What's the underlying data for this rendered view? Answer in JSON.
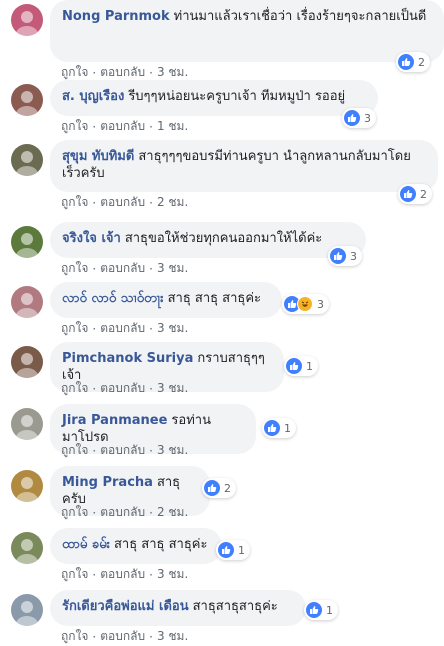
{
  "actions": {
    "like": "ถูกใจ",
    "reply": "ตอบกลับ",
    "dot": "·"
  },
  "comments": [
    {
      "name": "Nong Parnmok",
      "text": "ท่านมาแล้วเราเชื่อว่า เรื่องร้ายๆจะกลายเป็นดี",
      "time": "3 ชม.",
      "reactions": "2",
      "haha": false,
      "avatar_color": "#c45a7a"
    },
    {
      "name": "ส. บุญเรือง",
      "text": "รีบๆๆหน่อยนะครูบาเจ้า ทีมหมูป่า รออยู่",
      "time": "1 ชม.",
      "reactions": "3",
      "haha": false,
      "avatar_color": "#8b5a50"
    },
    {
      "name": "สุขุม ทับทิมดี",
      "text": "สาธุๆๆๆขอบรมีท่านครูบา นำลูกหลานกลับมาโดยเร็วครับ",
      "time": "2 ชม.",
      "reactions": "2",
      "haha": false,
      "avatar_color": "#6b6b52"
    },
    {
      "name": "จริงใจ เจ้า",
      "text": "สาธุขอให้ช่วยทุกคนออกมาให้ได้ค่ะ",
      "time": "3 ชม.",
      "reactions": "3",
      "haha": false,
      "avatar_color": "#5b7a3c"
    },
    {
      "name": "လာဝ် လာဝ် သၢဝ်တႃး",
      "text": "สาธุ สาธุ สาธุค่ะ",
      "time": "3 ชม.",
      "reactions": "3",
      "haha": true,
      "avatar_color": "#b07a80"
    },
    {
      "name": "Pimchanok Suriya",
      "text": "กราบสาธุๆๆเจ้า",
      "time": "3 ชม.",
      "reactions": "1",
      "haha": false,
      "avatar_color": "#7a5a48"
    },
    {
      "name": "Jira Panmanee",
      "text": "รอท่านมาโปรด",
      "time": "3 ชม.",
      "reactions": "1",
      "haha": false,
      "avatar_color": "#9a9a90"
    },
    {
      "name": "Ming Pracha",
      "text": "สาธุครับ",
      "time": "2 ชม.",
      "reactions": "2",
      "haha": false,
      "avatar_color": "#b08a40"
    },
    {
      "name": "ထာမ် ၶမ်း",
      "text": "สาธุ สาธุ สาธุค่ะ",
      "time": "3 ชม.",
      "reactions": "1",
      "haha": false,
      "avatar_color": "#7a8a5a"
    },
    {
      "name": "รักเดียวคือพ่อแม่ เดือน",
      "text": "สาธุสาธุสาธุค่ะ",
      "time": "3 ชม.",
      "reactions": "1",
      "haha": false,
      "avatar_color": "#8a9aaa"
    }
  ]
}
